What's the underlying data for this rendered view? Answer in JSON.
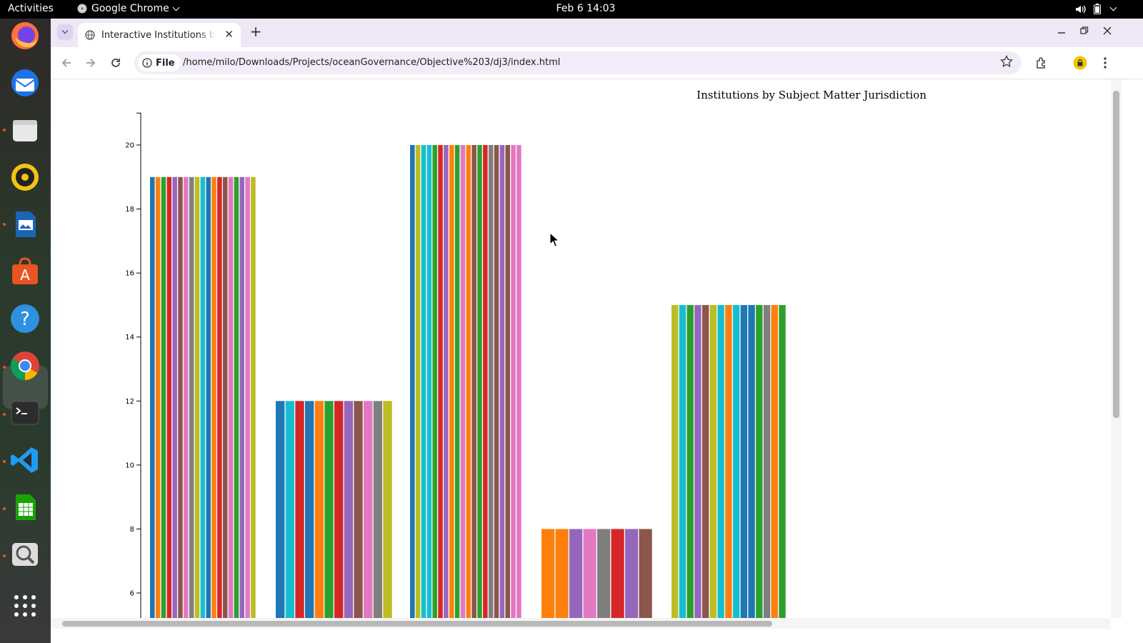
{
  "topbar": {
    "activities": "Activities",
    "app_name": "Google Chrome",
    "clock": "Feb 6  14:03",
    "tray_icons": [
      "volume-icon",
      "battery-icon",
      "system-menu-chevron-icon"
    ]
  },
  "dock": {
    "items": [
      {
        "name": "firefox",
        "icon": "firefox-icon"
      },
      {
        "name": "thunderbird",
        "icon": "thunderbird-icon"
      },
      {
        "name": "files",
        "icon": "files-icon"
      },
      {
        "name": "rhythmbox",
        "icon": "rhythmbox-icon"
      },
      {
        "name": "writer",
        "icon": "writer-icon"
      },
      {
        "name": "app-center",
        "icon": "app-center-icon"
      },
      {
        "name": "help",
        "icon": "help-icon"
      },
      {
        "name": "chrome",
        "icon": "chrome-icon",
        "active": true
      },
      {
        "name": "terminal",
        "icon": "terminal-icon"
      },
      {
        "name": "vscode",
        "icon": "vscode-icon"
      },
      {
        "name": "calc",
        "icon": "calc-icon"
      },
      {
        "name": "image-viewer",
        "icon": "image-viewer-icon"
      },
      {
        "name": "show-apps",
        "icon": "app-grid-icon"
      }
    ]
  },
  "browser": {
    "tab_title": "Interactive Institutions b",
    "new_tab_symbol": "+",
    "close_symbol": "✕",
    "chip_label": "File",
    "url": "/home/milo/Downloads/Projects/oceanGovernance/Objective%203/dj3/index.html"
  },
  "chart_data": {
    "type": "bar",
    "title": "Institutions by Subject Matter Jurisdiction",
    "xlabel": "",
    "ylabel": "",
    "visible_ylim": [
      5,
      21
    ],
    "yticks": [
      6,
      8,
      10,
      12,
      14,
      16,
      18,
      20
    ],
    "grid": false,
    "legend": "none",
    "groups": [
      {
        "value": 19,
        "segment_colors": [
          "#1f77b4",
          "#ff7f0e",
          "#2ca02c",
          "#d62728",
          "#9467bd",
          "#8c564b",
          "#e377c2",
          "#7f7f7f",
          "#bcbd22",
          "#17becf",
          "#1f77b4",
          "#ff7f0e",
          "#d62728",
          "#8c564b",
          "#e377c2",
          "#2ca02c",
          "#9467bd",
          "#e377c2",
          "#bcbd22"
        ]
      },
      {
        "value": 12,
        "segment_colors": [
          "#1f77b4",
          "#17becf",
          "#d62728",
          "#1f77b4",
          "#ff7f0e",
          "#2ca02c",
          "#d62728",
          "#9467bd",
          "#8c564b",
          "#e377c2",
          "#7f7f7f",
          "#bcbd22"
        ]
      },
      {
        "value": 20,
        "segment_colors": [
          "#1f77b4",
          "#bcbd22",
          "#17becf",
          "#17becf",
          "#2ca02c",
          "#d62728",
          "#9467bd",
          "#ff7f0e",
          "#2ca02c",
          "#e377c2",
          "#ff7f0e",
          "#8c564b",
          "#2ca02c",
          "#d62728",
          "#7f7f7f",
          "#8c564b",
          "#9467bd",
          "#8c564b",
          "#e377c2",
          "#e377c2"
        ]
      },
      {
        "value": 8,
        "segment_colors": [
          "#ff7f0e",
          "#ff7f0e",
          "#9467bd",
          "#e377c2",
          "#7f7f7f",
          "#d62728",
          "#9467bd",
          "#8c564b"
        ]
      },
      {
        "value": 15,
        "segment_colors": [
          "#bcbd22",
          "#17becf",
          "#2ca02c",
          "#9467bd",
          "#8c564b",
          "#bcbd22",
          "#17becf",
          "#ff7f0e",
          "#17becf",
          "#1f77b4",
          "#1f77b4",
          "#2ca02c",
          "#7f7f7f",
          "#ff7f0e",
          "#2ca02c"
        ]
      }
    ]
  }
}
